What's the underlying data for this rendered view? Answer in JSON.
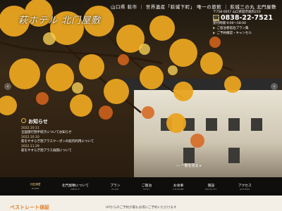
{
  "header": {
    "logo_text": "萩ホテル 北门屋敷",
    "tagline": "山口県 萩市 ｜ 世界遺産「萩城下町」 唯一の旅館 ｜ 萩城三の丸 北門屋敷",
    "address": "〒758-0057 山口県萩市堀内210",
    "phone": "0838-22-7521",
    "hours": "受付時間 9:00～18:00",
    "links": [
      "ご宿泊者宿泊プラン集",
      "ご予約確認・キャンセル"
    ]
  },
  "news": {
    "title": "お知らせ",
    "items": [
      {
        "date": "2022.10.11",
        "text": "全国旅行割手続きについてお知らせ"
      },
      {
        "date": "2022.10.10",
        "text": "萩をやすらぎ割プラスクーポンの館内利用について"
      },
      {
        "date": "2022.11.29",
        "text": "萩をやすらぎ割プラス再開について"
      }
    ],
    "list_link": "一覧を見る"
  },
  "nav": {
    "items": [
      {
        "jp": "HOME",
        "en": "HOME"
      },
      {
        "jp": "北門屋敷について",
        "en": "ABOUT"
      },
      {
        "jp": "プラン",
        "en": "PLAN"
      },
      {
        "jp": "ご宿泊",
        "en": "STAY"
      },
      {
        "jp": "お食事",
        "en": "CUISINE"
      },
      {
        "jp": "施設",
        "en": "FACILITY"
      },
      {
        "jp": "アクセス",
        "en": "ACCESS"
      }
    ]
  },
  "bottom": {
    "title": "ベストレート保証",
    "subtitle": "HPからのご予約が最もお得にご予約いただけます"
  },
  "colors": {
    "accent": "#e07d2a",
    "gold": "#b8a36e",
    "nav_bg": "#0f0e0c"
  }
}
